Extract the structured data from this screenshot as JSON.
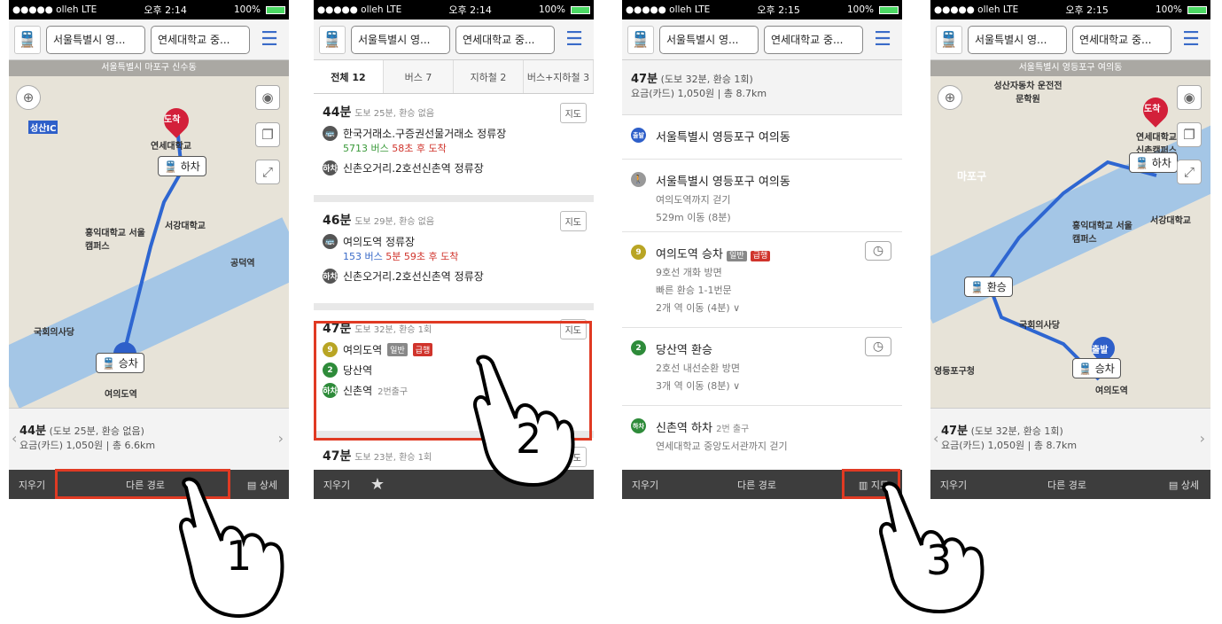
{
  "statusbar": {
    "carrier": "●●●●● olleh  LTE",
    "time1": "오후 2:14",
    "time2": "오후 2:15",
    "battery": "100%"
  },
  "header": {
    "from": "서울특별시 영...",
    "to": "연세대학교 중..."
  },
  "screen1": {
    "location": "서울특별시 마포구 신수동",
    "map_labels": [
      "도착",
      "연세대학교",
      "하차",
      "서강대학교",
      "홍익대학교 서울캠퍼스",
      "공덕역",
      "국회의사당",
      "승차",
      "여의도역",
      "성산IC"
    ],
    "summary_time": "44분",
    "summary_detail": "(도보 25분, 환승 없음)",
    "summary_fare": "요금(카드) 1,050원 | 총 6.6km",
    "bar_clear": "지우기",
    "bar_other": "다른 경로",
    "bar_detail": "상세"
  },
  "screen2": {
    "tabs": [
      "전체 12",
      "버스 7",
      "지하철 2",
      "버스+지하철 3"
    ],
    "cards": [
      {
        "time": "44분",
        "meta": "도보 25분, 환승 없음",
        "map": "지도",
        "l1": "한국거래소.구증권선물거래소 정류장",
        "l2a": "5713 버스",
        "l2b": "58초 후 도착",
        "l3": "신촌오거리.2호선신촌역 정류장"
      },
      {
        "time": "46분",
        "meta": "도보 29분, 환승 없음",
        "map": "지도",
        "l1": "여의도역 정류장",
        "l2a": "153 버스",
        "l2b": "5분 59초 후 도착",
        "l3": "신촌오거리.2호선신촌역 정류장"
      },
      {
        "time": "47분",
        "meta": "도보 32분, 환승 1회",
        "map": "지도",
        "l1": "여의도역",
        "t1": "일반",
        "t2": "급행",
        "l2": "당산역",
        "l3": "신촌역",
        "l3s": "2번출구"
      },
      {
        "time": "47분",
        "meta": "도보 23분, 환승 1회",
        "map": "지도"
      }
    ],
    "bar_clear": "지우기"
  },
  "screen3": {
    "time": "47분",
    "meta": "(도보 32분, 환승 1회)",
    "fare": "요금(카드) 1,050원 | 총 8.7km",
    "steps": [
      {
        "badge": "출발",
        "title": "서울특별시 영등포구 여의동"
      },
      {
        "title": "서울특별시 영등포구 여의동",
        "s1": "여의도역까지 걷기",
        "s2": "529m 이동 (8분)"
      },
      {
        "badge": "9",
        "title": "여의도역 승차",
        "t1": "일반",
        "t2": "급행",
        "s1": "9호선 개화 방면",
        "s2": "빠른 환승 1-1번문",
        "s3": "2개 역 이동 (4분) ∨"
      },
      {
        "badge": "2",
        "title": "당산역 환승",
        "s1": "2호선 내선순환 방면",
        "s2": "3개 역 이동 (8분) ∨"
      },
      {
        "badge": "하차",
        "title": "신촌역 하차",
        "t1": "2번 출구",
        "s1": "연세대학교 중앙도서관까지 걷기"
      }
    ],
    "bar_clear": "지우기",
    "bar_other": "다른 경로",
    "bar_map": "지도"
  },
  "screen4": {
    "location": "서울특별시 영등포구 여의동",
    "map_labels": [
      "성산자동차 운전전문학원",
      "도착",
      "연세대학교 신촌캠퍼스",
      "하차",
      "서강대학교",
      "홍익대학교 서울캠퍼스",
      "환승",
      "국회의사당",
      "출발",
      "승차",
      "여의도역",
      "영등포구청",
      "마포구"
    ],
    "summary_time": "47분",
    "summary_detail": "(도보 32분, 환승 1회)",
    "summary_fare": "요금(카드) 1,050원 | 총 8.7km",
    "bar_clear": "지우기",
    "bar_other": "다른 경로",
    "bar_detail": "상세"
  },
  "steps_nums": [
    "1",
    "2",
    "3"
  ]
}
